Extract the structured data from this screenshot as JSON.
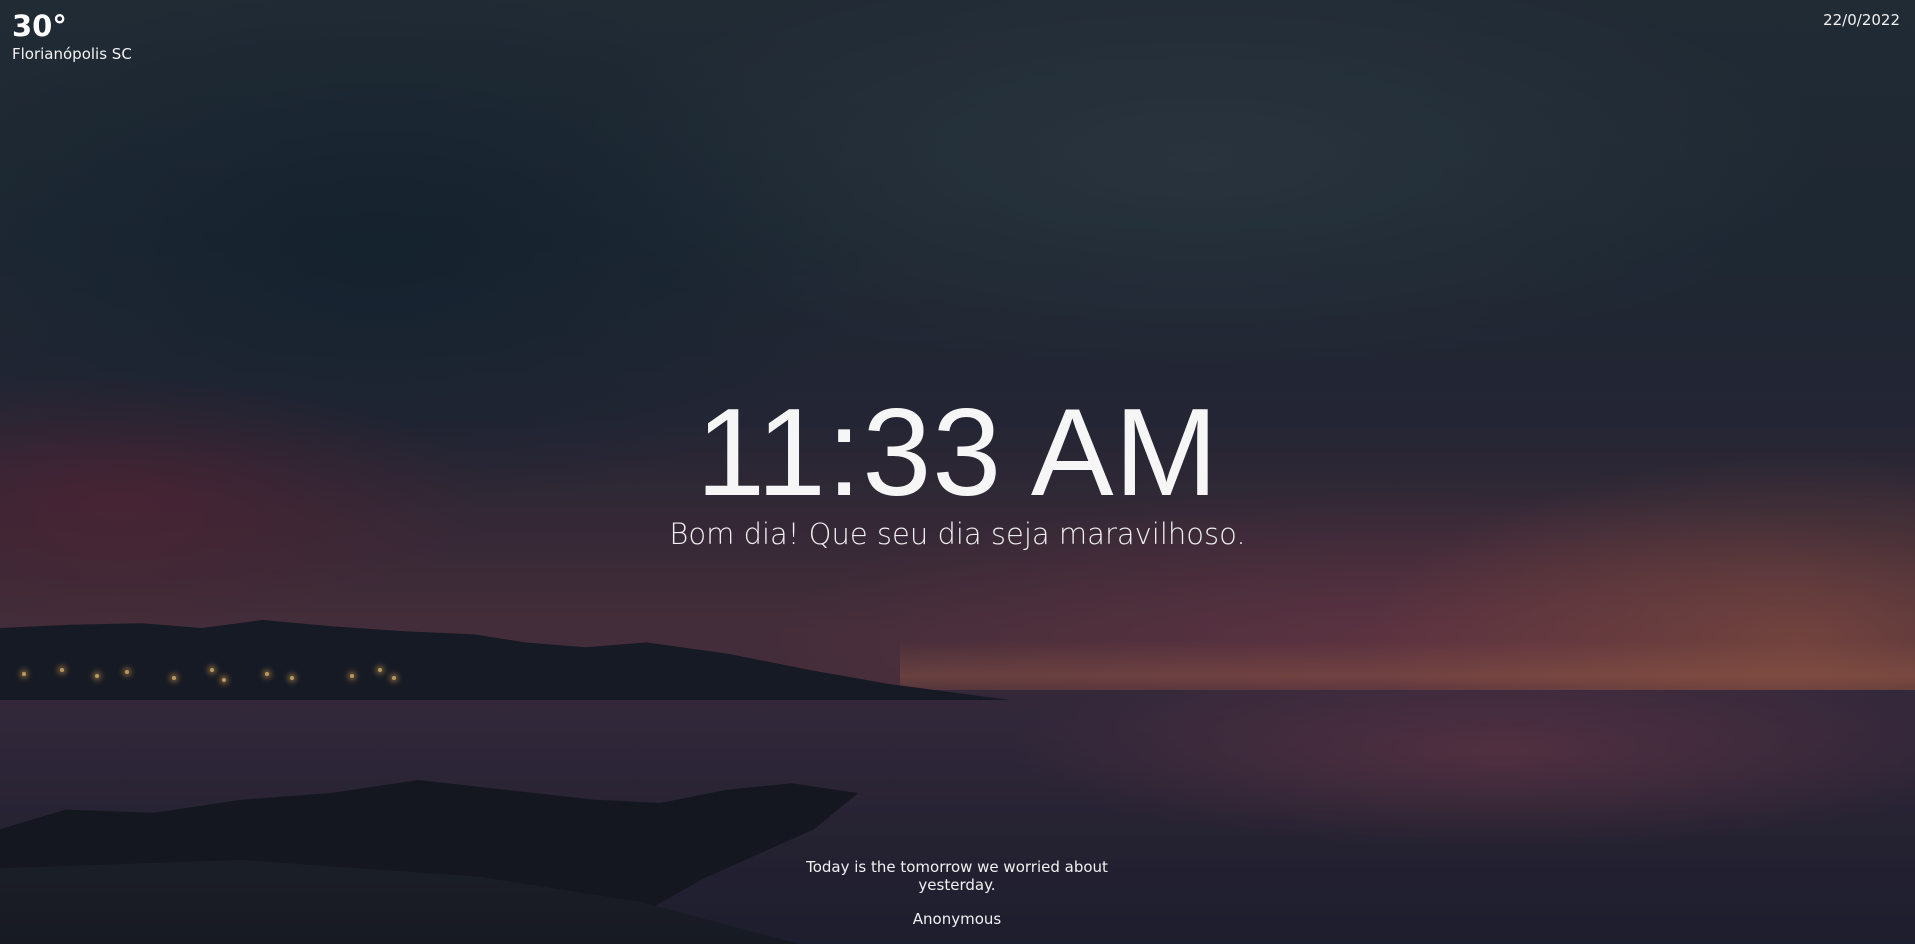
{
  "weather": {
    "temperature": "30°",
    "location": "Florianópolis SC"
  },
  "date": "22/0/2022",
  "clock": {
    "time": "11:33 AM",
    "greeting": "Bom dia! Que seu dia seja maravilhoso."
  },
  "quote": {
    "text": "Today is the tomorrow we worried about yesterday.",
    "author": "Anonymous"
  }
}
